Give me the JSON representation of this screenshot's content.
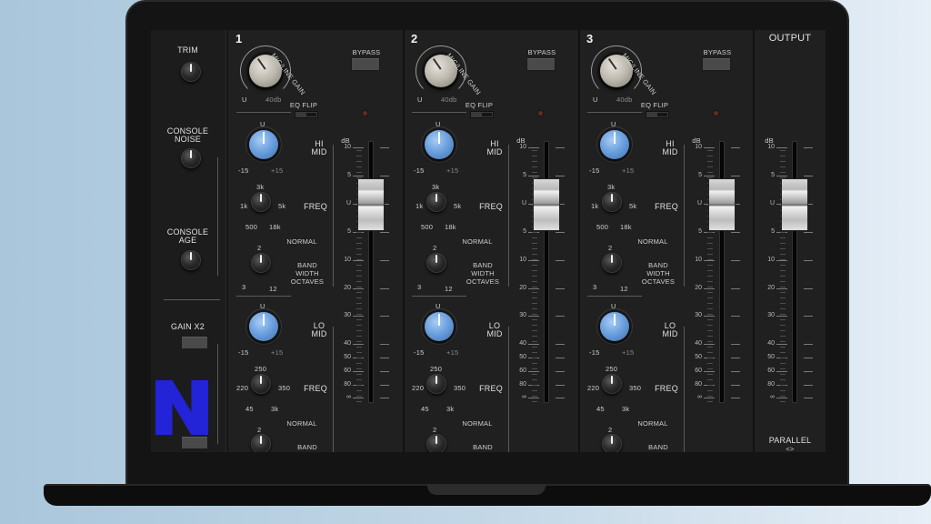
{
  "left_rail": {
    "trim": "TRIM",
    "console_noise": "CONSOLE\nNOISE",
    "console_age": "CONSOLE\nAGE",
    "gain_x2": "GAIN X2",
    "logo_text": "N"
  },
  "channels": [
    {
      "number": "1"
    },
    {
      "number": "2"
    },
    {
      "number": "3"
    }
  ],
  "channel_labels": {
    "mic_line_gain": "MIC/LINE GAIN",
    "gain_min": "U",
    "gain_max": "40db",
    "bypass": "BYPASS",
    "eq_flip": "EQ FLIP",
    "hi_mid": "HI\nMID",
    "lo_mid": "LO\nMID",
    "freq": "FREQ",
    "bandwidth": "BAND\nWIDTH\nOCTAVES",
    "normal": "NORMAL",
    "gain_u": "U",
    "gain_neg": "-15",
    "gain_pos": "+15",
    "hi_freq_marks": [
      "3k",
      "1k",
      "5k",
      "500",
      "18k"
    ],
    "lo_freq_marks": [
      "250",
      "220",
      "350",
      "45",
      "3k"
    ],
    "bw_marks": [
      "2",
      "3",
      "12"
    ]
  },
  "fader_scale": {
    "unit": "dB",
    "marks": [
      "10",
      "5",
      "U",
      "5",
      "10",
      "20",
      "30",
      "40",
      "50",
      "60",
      "80",
      "∞"
    ]
  },
  "output": {
    "title": "OUTPUT",
    "parallel": "PARALLEL",
    "parallel_arrows": "<>",
    "parallel_sub": "PARA"
  },
  "colors": {
    "panel": "#202020",
    "blue_knob": "#6da1df",
    "logo": "#2323d8"
  }
}
